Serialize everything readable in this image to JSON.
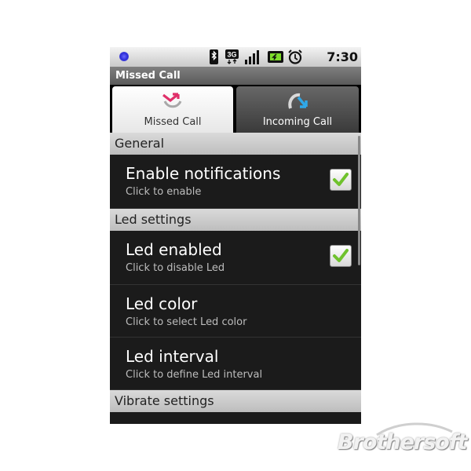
{
  "status_bar": {
    "time": "7:30 AM",
    "icons": [
      "notification-dot-icon",
      "bluetooth-icon",
      "3g-icon",
      "signal-strength-icon",
      "battery-icon",
      "alarm-clock-icon"
    ],
    "network_label": "3G"
  },
  "title_bar": {
    "title": "Missed Call"
  },
  "tabs": [
    {
      "label": "Missed Call",
      "icon": "missed-call-icon",
      "selected": true
    },
    {
      "label": "Incoming Call",
      "icon": "incoming-call-icon",
      "selected": false
    }
  ],
  "sections": {
    "general": "General",
    "led": "Led settings",
    "vibrate": "Vibrate settings"
  },
  "settings": {
    "enable_notifications": {
      "title": "Enable notifications",
      "summary": "Click to enable",
      "checked": true
    },
    "led_enabled": {
      "title": "Led enabled",
      "summary": "Click to disable Led",
      "checked": true
    },
    "led_color": {
      "title": "Led color",
      "summary": "Click to select Led color"
    },
    "led_interval": {
      "title": "Led interval",
      "summary": "Click to define Led interval"
    }
  },
  "watermark": {
    "text": "Brothersoft"
  },
  "colors": {
    "checkmark": "#6fc22d",
    "missed_icon": "#e0306a",
    "incoming_arrow": "#2fa8e8",
    "section_bg": "#cfcfcf",
    "list_bg": "#1b1b1b"
  }
}
